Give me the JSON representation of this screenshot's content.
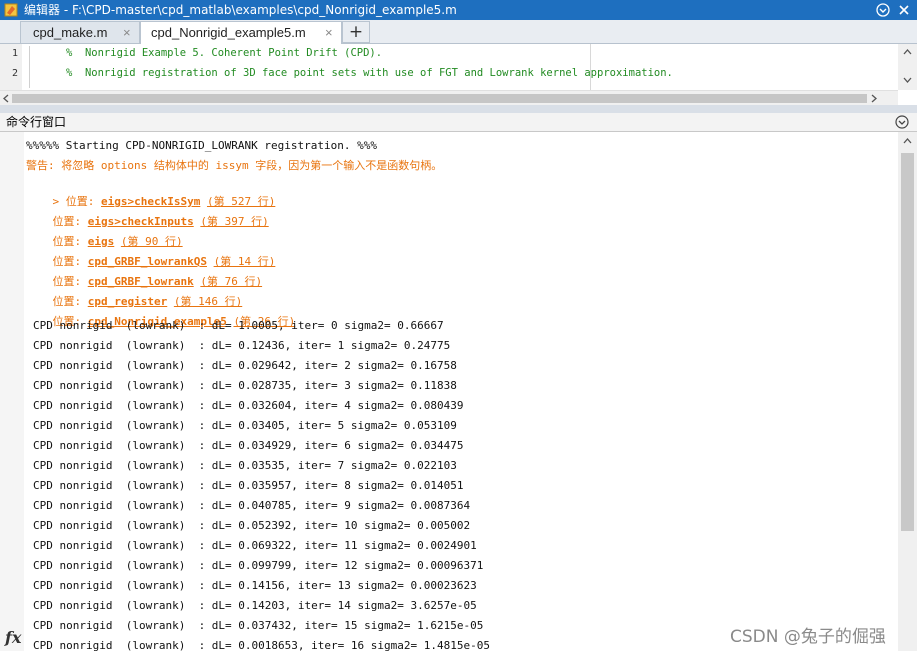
{
  "window": {
    "title": "编辑器 - F:\\CPD-master\\cpd_matlab\\examples\\cpd_Nonrigid_example5.m"
  },
  "tabs": [
    {
      "label": "cpd_make.m",
      "close": "×"
    },
    {
      "label": "cpd_Nonrigid_example5.m",
      "close": "×"
    }
  ],
  "add_tab_label": "+",
  "editor": {
    "lines": [
      {
        "num": "1",
        "text": "%  Nonrigid Example 5. Coherent Point Drift (CPD)."
      },
      {
        "num": "2",
        "text": "%  Nonrigid registration of 3D face point sets with use of FGT and Lowrank kernel approximation."
      }
    ]
  },
  "command_window": {
    "title": "命令行窗口",
    "fx_label": "fx",
    "header_line": "%%%%% Starting CPD-NONRIGID_LOWRANK registration. %%%",
    "warning_line": "警告: 将忽略 options 结构体中的 issym 字段，因为第一个输入不是函数句柄。",
    "stack": [
      {
        "prefix": "> 位置: ",
        "func": "eigs>checkIsSym",
        "line": "(第 527 行)"
      },
      {
        "prefix": "位置: ",
        "func": "eigs>checkInputs",
        "line": "(第 397 行)"
      },
      {
        "prefix": "位置: ",
        "func": "eigs",
        "line": "(第 90 行)"
      },
      {
        "prefix": "位置: ",
        "func": "cpd_GRBF_lowrankQS",
        "line": "(第 14 行)"
      },
      {
        "prefix": "位置: ",
        "func": "cpd_GRBF_lowrank",
        "line": "(第 76 行)"
      },
      {
        "prefix": "位置: ",
        "func": "cpd_register",
        "line": "(第 146 行)"
      },
      {
        "prefix": "位置: ",
        "func": "cpd_Nonrigid_example5",
        "line": "(第 26 行)"
      }
    ],
    "iterations": [
      "CPD nonrigid  (lowrank)  : dL= 1.0005, iter= 0 sigma2= 0.66667",
      "CPD nonrigid  (lowrank)  : dL= 0.12436, iter= 1 sigma2= 0.24775",
      "CPD nonrigid  (lowrank)  : dL= 0.029642, iter= 2 sigma2= 0.16758",
      "CPD nonrigid  (lowrank)  : dL= 0.028735, iter= 3 sigma2= 0.11838",
      "CPD nonrigid  (lowrank)  : dL= 0.032604, iter= 4 sigma2= 0.080439",
      "CPD nonrigid  (lowrank)  : dL= 0.03405, iter= 5 sigma2= 0.053109",
      "CPD nonrigid  (lowrank)  : dL= 0.034929, iter= 6 sigma2= 0.034475",
      "CPD nonrigid  (lowrank)  : dL= 0.03535, iter= 7 sigma2= 0.022103",
      "CPD nonrigid  (lowrank)  : dL= 0.035957, iter= 8 sigma2= 0.014051",
      "CPD nonrigid  (lowrank)  : dL= 0.040785, iter= 9 sigma2= 0.0087364",
      "CPD nonrigid  (lowrank)  : dL= 0.052392, iter= 10 sigma2= 0.005002",
      "CPD nonrigid  (lowrank)  : dL= 0.069322, iter= 11 sigma2= 0.0024901",
      "CPD nonrigid  (lowrank)  : dL= 0.099799, iter= 12 sigma2= 0.00096371",
      "CPD nonrigid  (lowrank)  : dL= 0.14156, iter= 13 sigma2= 0.00023623",
      "CPD nonrigid  (lowrank)  : dL= 0.14203, iter= 14 sigma2= 3.6257e-05",
      "CPD nonrigid  (lowrank)  : dL= 0.037432, iter= 15 sigma2= 1.6215e-05",
      "CPD nonrigid  (lowrank)  : dL= 0.0018653, iter= 16 sigma2= 1.4815e-05"
    ]
  },
  "watermark": "CSDN @兔子的倔强",
  "colors": {
    "titlebar": "#1e6fbf",
    "comment_green": "#228b22",
    "warning_orange": "#e8740f"
  }
}
